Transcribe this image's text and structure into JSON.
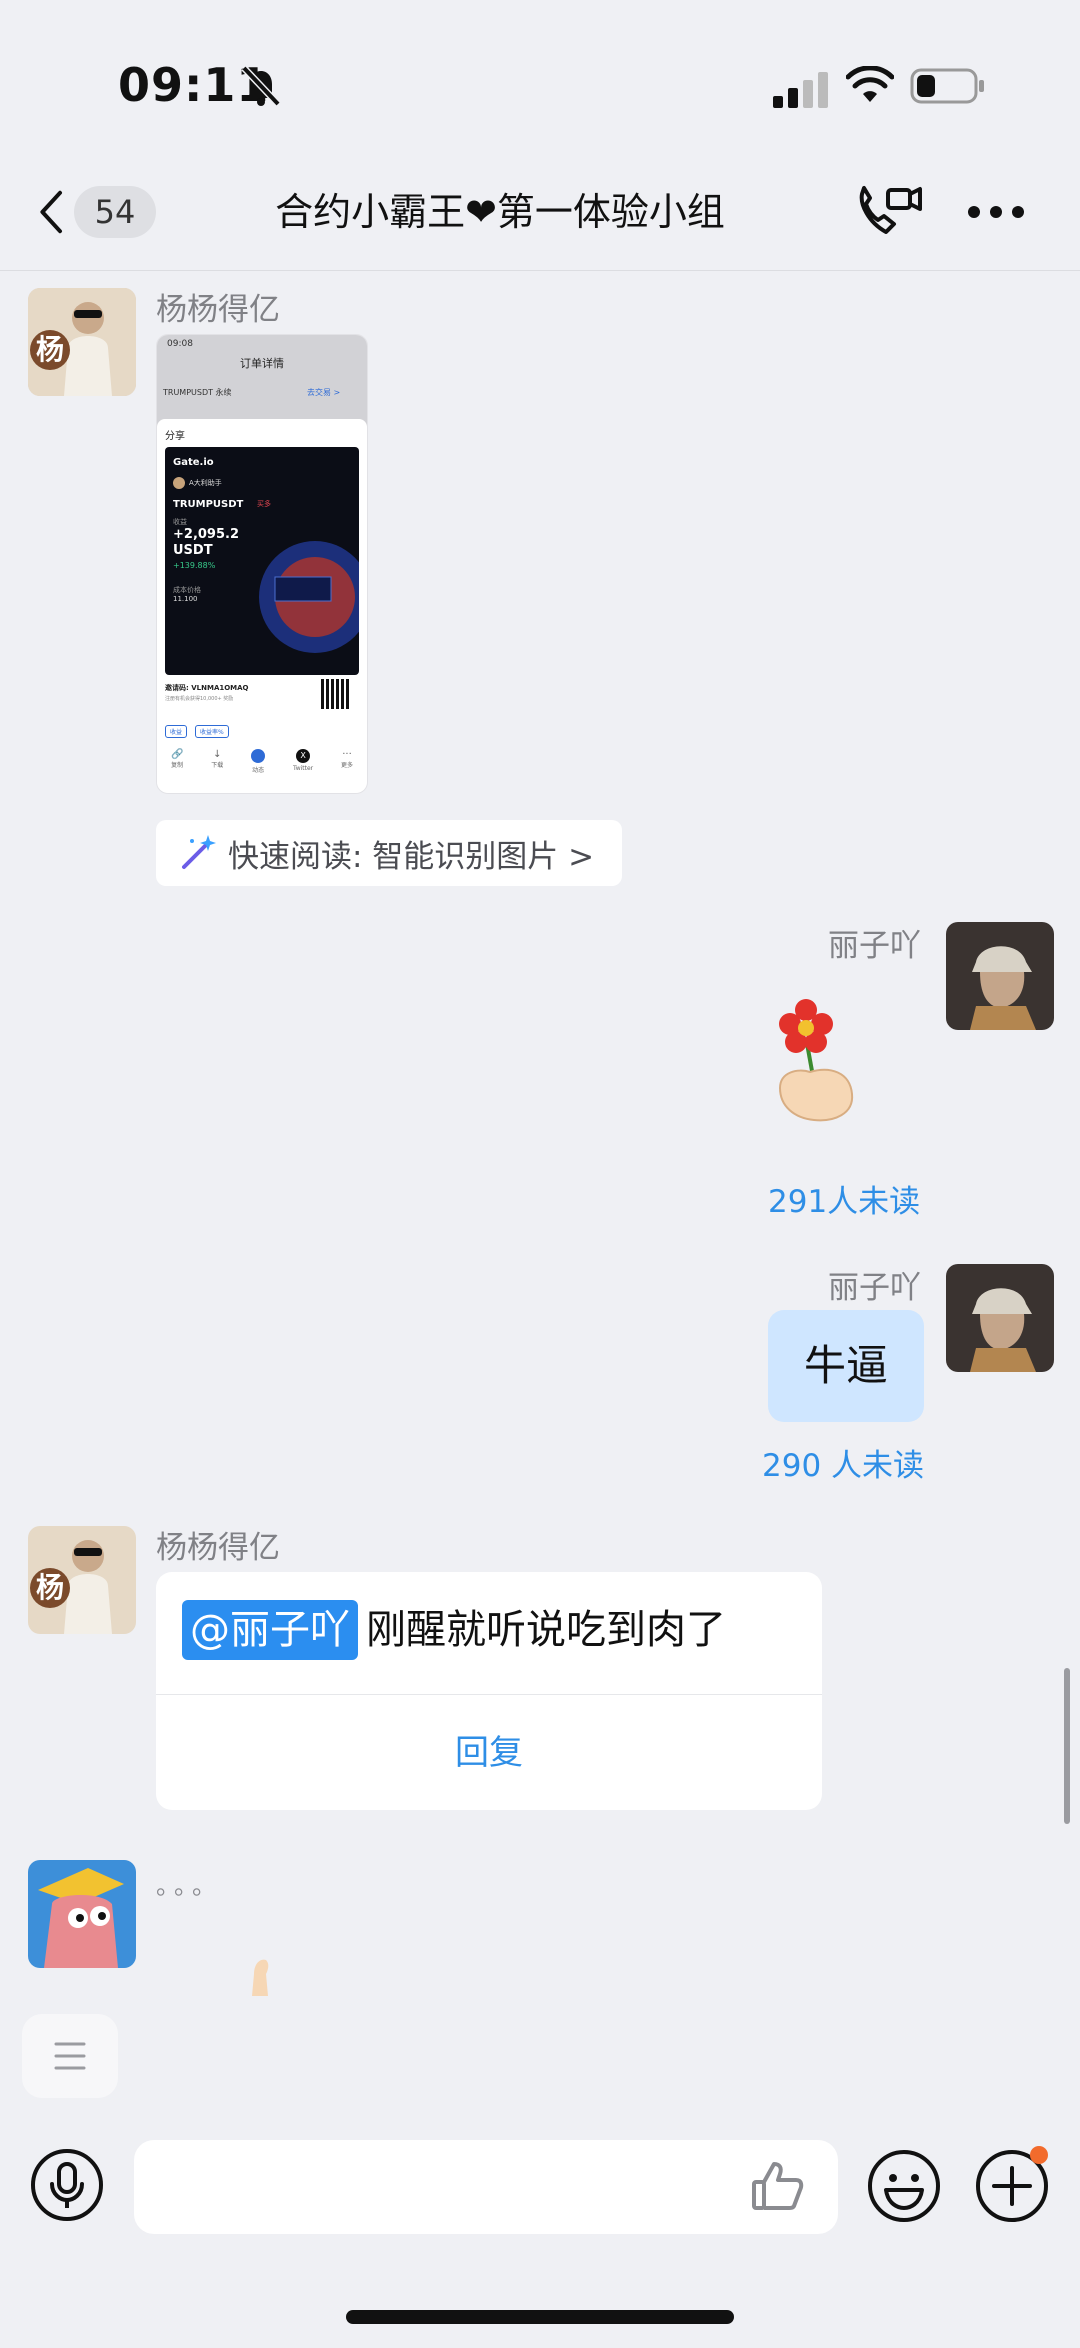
{
  "status_bar": {
    "time": "09:11"
  },
  "nav": {
    "unread_count": "54",
    "title": "合约小霸王❤第一体验小组"
  },
  "messages": [
    {
      "sender": "杨杨得亿",
      "avatar_char": "杨",
      "screenshot": {
        "header_time": "09:08",
        "header_title": "订单详情",
        "row1": "TRUMPUSDT 永续",
        "row1_link": "去交易 >",
        "share_label": "分享",
        "brand": "Gate.io",
        "username": "A大利助手",
        "pair": "TRUMPUSDT",
        "tag": "买多",
        "pnl_label": "收益",
        "pnl_value": "+2,095.2",
        "pnl_unit": "USDT",
        "pnl_percent": "+139.88%",
        "price_label": "成本价格",
        "price_value": "11.100",
        "invite_label": "邀请码: VLNMA1OMAQ",
        "invite_sub": "注册有机会获得10,000+ 奖励",
        "chip1": "收益",
        "chip2": "收益率%",
        "actions": [
          "复制",
          "下载",
          "动态",
          "Twitter",
          "更多"
        ]
      },
      "quick_read": "快速阅读: 智能识别图片 >"
    },
    {
      "sender": "丽子吖",
      "type": "sticker",
      "read_status": "291人未读"
    },
    {
      "sender": "丽子吖",
      "text": "牛逼",
      "read_status": "290 人未读"
    },
    {
      "sender": "杨杨得亿",
      "avatar_char": "杨",
      "mention": "@丽子吖",
      "text": "刚醒就听说吃到肉了",
      "reply_label": "回复"
    },
    {
      "typing": "。。。"
    }
  ],
  "colors": {
    "accent": "#2e8ee6",
    "bubble": "#cfe6ff",
    "badge_dot": "#f26b2c"
  }
}
